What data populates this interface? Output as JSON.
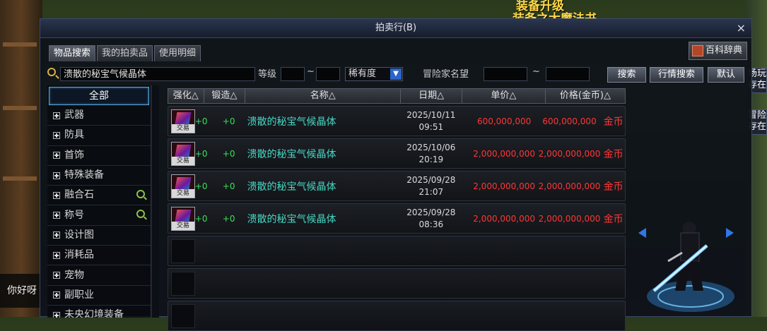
{
  "background": {
    "top_text_1": "装备升级",
    "top_text_2": "装备之大魔法书",
    "hello": "你好呀",
    "side_buttons": [
      "场玩",
      "存在",
      "冒险",
      "存在"
    ]
  },
  "window": {
    "title": "拍卖行(B)",
    "close_label": "×"
  },
  "tabs": [
    "物品搜索",
    "我的拍卖品",
    "使用明细"
  ],
  "dict_button": "百科辞典",
  "search": {
    "query": "溃散的秘宝气候晶体",
    "level_label": "等级",
    "level_min": "",
    "level_sep": "~",
    "level_max": "",
    "rarity_label": "稀有度",
    "seller_label": "冒险家名望",
    "fame_min": "",
    "fame_sep": "~",
    "fame_max": "",
    "search_button": "搜索",
    "market_button": "行情搜索",
    "default_button": "默认"
  },
  "categories": [
    {
      "label": "全部",
      "active": true,
      "expand": false,
      "zoom": false
    },
    {
      "label": "武器",
      "expand": true,
      "zoom": false
    },
    {
      "label": "防具",
      "expand": true,
      "zoom": false
    },
    {
      "label": "首饰",
      "expand": true,
      "zoom": false
    },
    {
      "label": "特殊装备",
      "expand": true,
      "zoom": false
    },
    {
      "label": "融合石",
      "expand": true,
      "zoom": true
    },
    {
      "label": "称号",
      "expand": true,
      "zoom": true
    },
    {
      "label": "设计图",
      "expand": true,
      "zoom": false
    },
    {
      "label": "消耗品",
      "expand": true,
      "zoom": false
    },
    {
      "label": "宠物",
      "expand": true,
      "zoom": false
    },
    {
      "label": "副职业",
      "expand": true,
      "zoom": false
    },
    {
      "label": "未央幻境装备",
      "expand": true,
      "zoom": false
    }
  ],
  "table": {
    "headers": [
      "强化△",
      "锻造△",
      "名称△",
      "日期△",
      "单价△",
      "价格(金币)△"
    ],
    "trade_badge": "交易",
    "currency": "金币",
    "rows": [
      {
        "enhance": "+0",
        "forge": "+0",
        "name": "溃散的秘宝气候晶体",
        "date": "2025/10/11",
        "time": "09:51",
        "unit_price": "600,000,000",
        "price": "600,000,000"
      },
      {
        "enhance": "+0",
        "forge": "+0",
        "name": "溃散的秘宝气候晶体",
        "date": "2025/10/06",
        "time": "20:19",
        "unit_price": "2,000,000,000",
        "price": "2,000,000,000"
      },
      {
        "enhance": "+0",
        "forge": "+0",
        "name": "溃散的秘宝气候晶体",
        "date": "2025/09/28",
        "time": "21:07",
        "unit_price": "2,000,000,000",
        "price": "2,000,000,000"
      },
      {
        "enhance": "+0",
        "forge": "+0",
        "name": "溃散的秘宝气候晶体",
        "date": "2025/09/28",
        "time": "08:36",
        "unit_price": "2,000,000,000",
        "price": "2,000,000,000"
      }
    ],
    "empty_rows": 3
  }
}
